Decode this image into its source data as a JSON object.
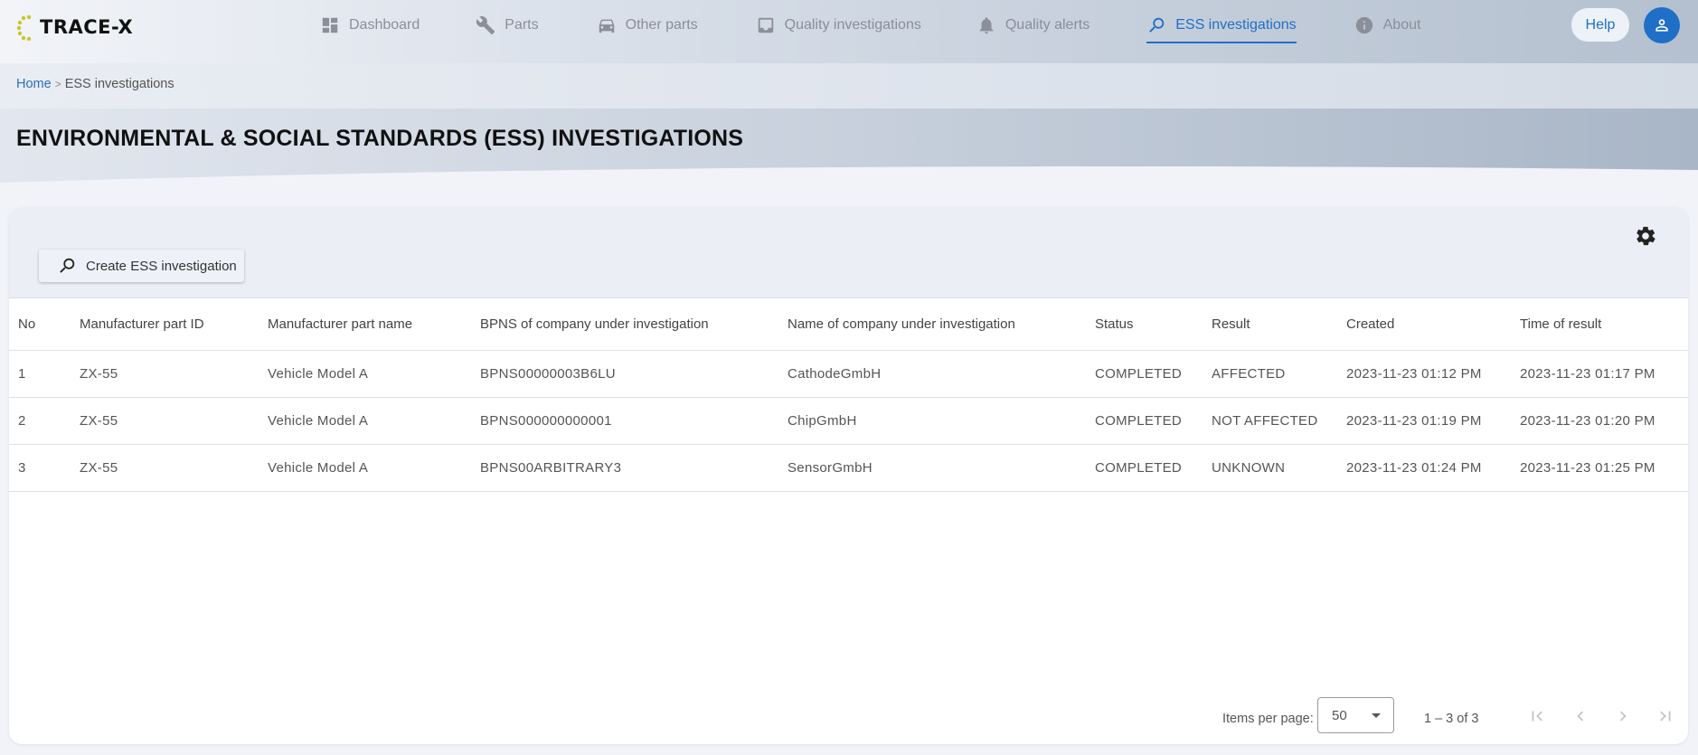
{
  "app": {
    "logo_text": "TRACE-X"
  },
  "nav": {
    "items": [
      {
        "label": "Dashboard",
        "icon": "dashboard-icon"
      },
      {
        "label": "Parts",
        "icon": "wrench-icon"
      },
      {
        "label": "Other parts",
        "icon": "car-icon"
      },
      {
        "label": "Quality investigations",
        "icon": "inbox-icon"
      },
      {
        "label": "Quality alerts",
        "icon": "bell-icon"
      },
      {
        "label": "ESS investigations",
        "icon": "search-icon",
        "active": true
      },
      {
        "label": "About",
        "icon": "info-icon"
      }
    ],
    "help_label": "Help",
    "user_icon": "person-icon"
  },
  "breadcrumb": {
    "home": "Home",
    "separator": ">",
    "current": "ESS investigations"
  },
  "page": {
    "title": "ENVIRONMENTAL & SOCIAL STANDARDS (ESS) INVESTIGATIONS"
  },
  "toolbar": {
    "create_label": "Create ESS investigation",
    "settings_icon": "gear-icon"
  },
  "table": {
    "columns": [
      "No",
      "Manufacturer part ID",
      "Manufacturer part name",
      "BPNS of company under investigation",
      "Name of company under investigation",
      "Status",
      "Result",
      "Created",
      "Time of result"
    ],
    "rows": [
      [
        "1",
        "ZX-55",
        "Vehicle Model A",
        "BPNS00000003B6LU",
        "CathodeGmbH",
        "COMPLETED",
        "AFFECTED",
        "2023-11-23 01:12 PM",
        "2023-11-23 01:17 PM"
      ],
      [
        "2",
        "ZX-55",
        "Vehicle Model A",
        "BPNS000000000001",
        "ChipGmbH",
        "COMPLETED",
        "NOT AFFECTED",
        "2023-11-23 01:19 PM",
        "2023-11-23 01:20 PM"
      ],
      [
        "3",
        "ZX-55",
        "Vehicle Model A",
        "BPNS00ARBITRARY3",
        "SensorGmbH",
        "COMPLETED",
        "UNKNOWN",
        "2023-11-23 01:24 PM",
        "2023-11-23 01:25 PM"
      ]
    ]
  },
  "paginator": {
    "items_per_page_label": "Items per page:",
    "items_per_page_value": "50",
    "range_label": "1 – 3 of 3"
  },
  "colors": {
    "accent": "#1f6fc7",
    "logo_ring": "#c9c72b"
  }
}
